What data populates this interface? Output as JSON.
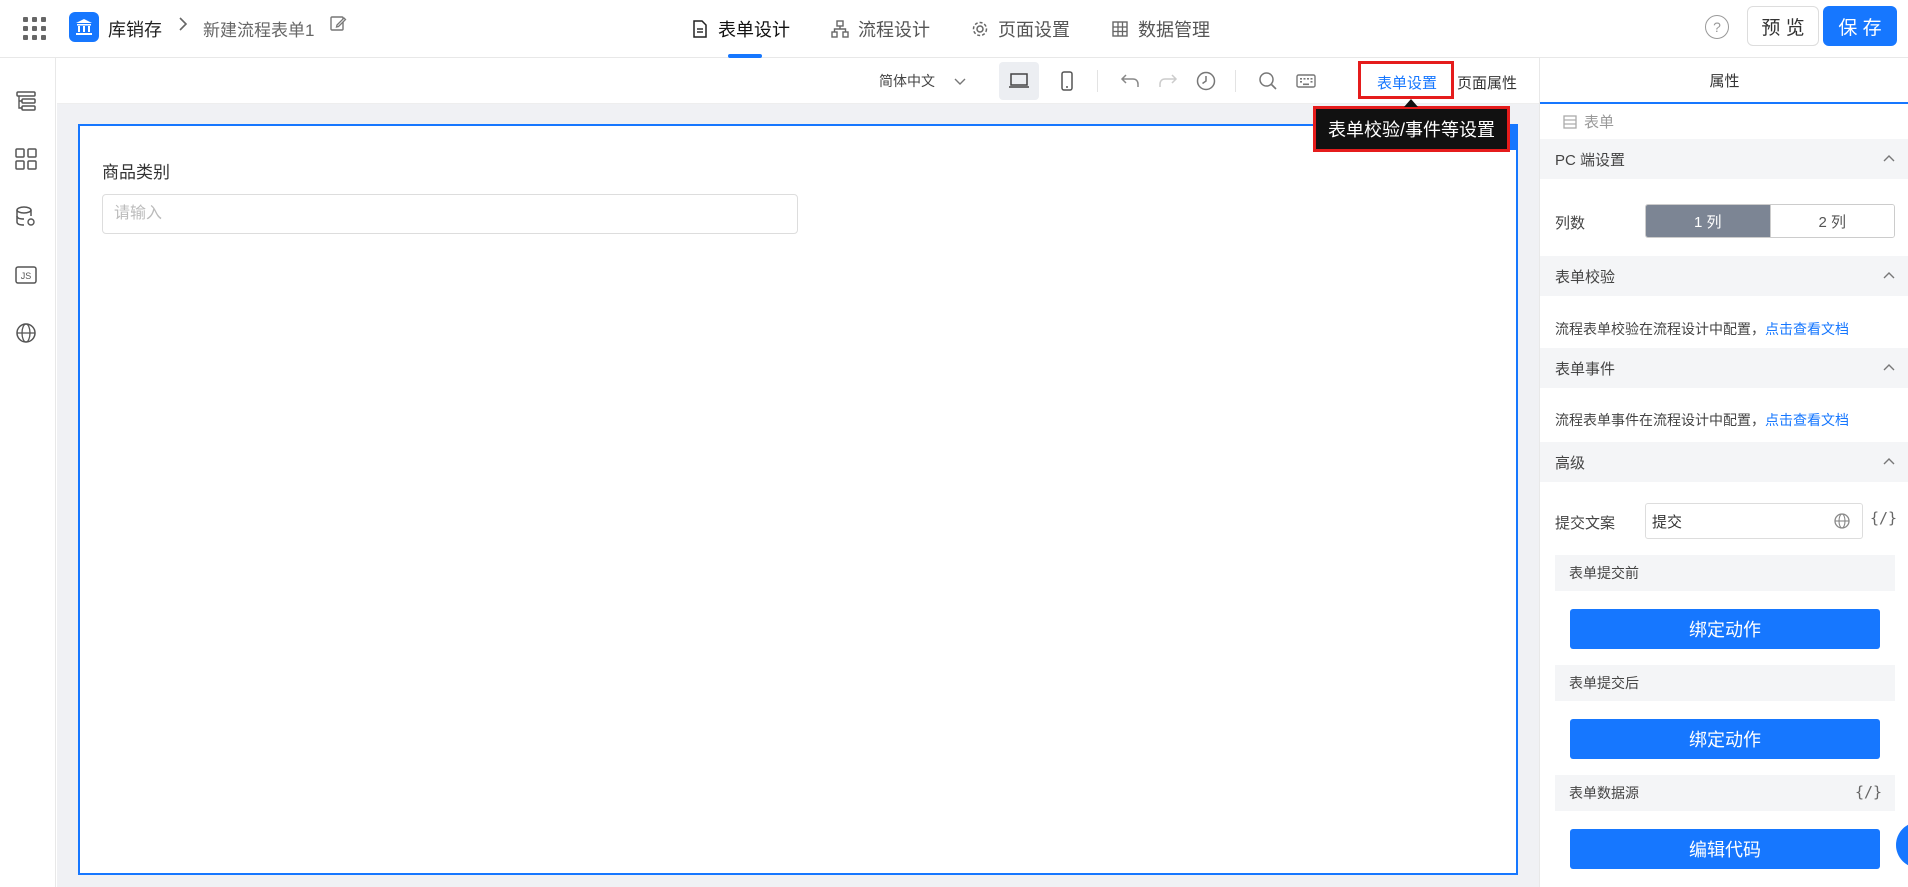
{
  "header": {
    "app_name": "库销存",
    "breadcrumb_separator": ">",
    "form_name": "新建流程表单1",
    "tabs": [
      {
        "label": "表单设计",
        "icon": "document-icon",
        "active": true
      },
      {
        "label": "流程设计",
        "icon": "flowchart-icon",
        "active": false
      },
      {
        "label": "页面设置",
        "icon": "gear-icon",
        "active": false
      },
      {
        "label": "数据管理",
        "icon": "table-icon",
        "active": false
      }
    ],
    "help_symbol": "?",
    "preview_label": "预 览",
    "save_label": "保 存"
  },
  "left_rail": {
    "icons": [
      "outline-tree-icon",
      "components-grid-icon",
      "data-source-icon",
      "js-code-icon",
      "globe-icon"
    ],
    "js_text": "JS"
  },
  "toolbar": {
    "language": "简体中文",
    "form_settings_label": "表单设置",
    "page_props_label": "页面属性"
  },
  "tooltip": {
    "text": "表单校验/事件等设置"
  },
  "canvas": {
    "field_label": "商品类别",
    "field_placeholder": "请输入"
  },
  "right_panel": {
    "tab_label": "属性",
    "node_label": "表单",
    "pc_section": "PC 端设置",
    "columns_label": "列数",
    "column_options": [
      "1 列",
      "2 列"
    ],
    "validation_section": "表单校验",
    "validation_text": "流程表单校验在流程设计中配置，",
    "validation_link": "点击查看文档",
    "events_section": "表单事件",
    "events_text": "流程表单事件在流程设计中配置，",
    "events_link": "点击查看文档",
    "advanced_section": "高级",
    "submit_text_label": "提交文案",
    "submit_text_value": "提交",
    "code_symbol": "{/}",
    "before_submit_label": "表单提交前",
    "after_submit_label": "表单提交后",
    "datasource_label": "表单数据源",
    "bind_action_label": "绑定动作",
    "edit_code_label": "编辑代码"
  },
  "colors": {
    "accent": "#1677ff",
    "highlight": "#e51c1c",
    "segment_active": "#7c8594"
  }
}
